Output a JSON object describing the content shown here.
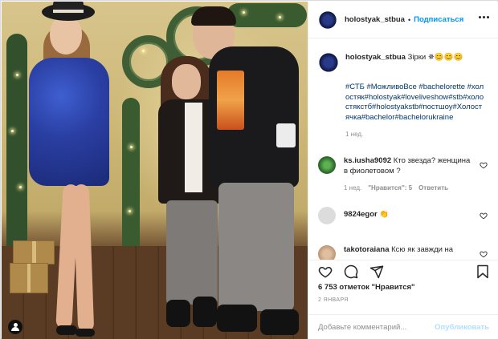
{
  "post": {
    "username": "holostyak_stbua",
    "follow_label": "Подписаться",
    "separator": "•"
  },
  "caption": {
    "username": "holostyak_stbua",
    "text": "Зірки ✵😊😊😊",
    "hashtags": "#СТБ #МожливоВсе #bachelorette #холостяк#holostyak#loveliveshow#stb#холостякстб#holostyakstb#постшоу#Холостячка#bachelor#bachelorukraine",
    "time": "1 нед."
  },
  "comments": [
    {
      "username": "ks.iusha9092",
      "text": "Кто звезда? женщина в фиолетовом ?",
      "time": "1 нед.",
      "likes_label": "\"Нравится\": 5",
      "reply_label": "Ответить",
      "avatar_color": "#2f6e2c"
    },
    {
      "username": "9824egor",
      "text": "👏",
      "avatar_color": "#dcdcdc"
    },
    {
      "username": "takotoraiana",
      "text": "Ксю як завжди на",
      "avatar_color": "#c79a6e"
    }
  ],
  "actions": {
    "likes_text": "6 753 отметок \"Нравится\"",
    "date": "2 ЯНВАРЯ",
    "icons": [
      "heart-icon",
      "comment-icon",
      "share-icon",
      "bookmark-icon"
    ]
  },
  "add_comment": {
    "placeholder": "Добавьте комментарий...",
    "publish_label": "Опубликовать"
  },
  "colors": {
    "link": "#0095f6",
    "hashtag": "#00376b",
    "muted": "#8e8e8e",
    "publish_disabled": "#b2dffc"
  }
}
